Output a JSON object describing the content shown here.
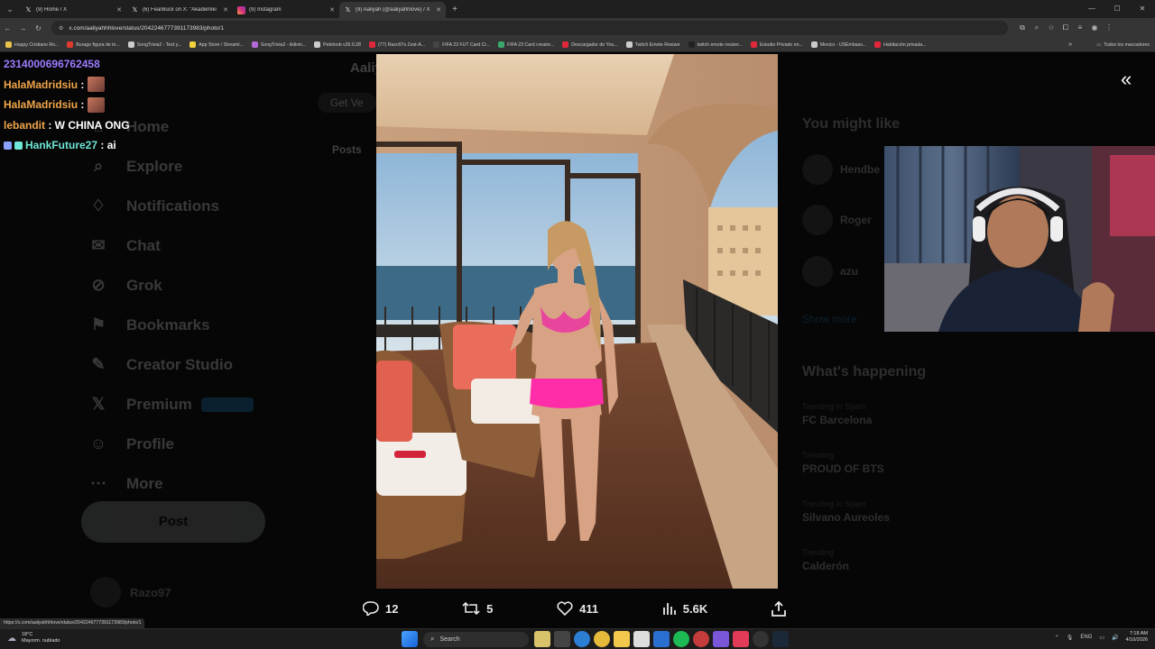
{
  "browser": {
    "tabs": [
      {
        "label": "(9) Home / X",
        "icon": "x-logo-icon",
        "active": false
      },
      {
        "label": "(6) FearBuck on X: \"Akademiki",
        "icon": "x-logo-icon",
        "active": false
      },
      {
        "label": "(9) Instagram",
        "icon": "instagram-icon",
        "active": false
      },
      {
        "label": "(9) Aaliyah (@aaliyahhlove) / X",
        "icon": "x-logo-icon",
        "active": true
      }
    ],
    "url": "x.com/aaliyahhhlove/status/2042246777391173983/photo/1",
    "bookmarks": [
      {
        "label": "Happy Cristiano Ro...",
        "color": "#e8c24a"
      },
      {
        "label": "Burago figura de to...",
        "color": "#e03b2e"
      },
      {
        "label": "SongTrivia2 - Test y...",
        "color": "#cccccc"
      },
      {
        "label": "App Store / Streami...",
        "color": "#f4d23a"
      },
      {
        "label": "SongTrivia2 - Adivin...",
        "color": "#b36ad9"
      },
      {
        "label": "Peletoob v26.0.28",
        "color": "#cccccc"
      },
      {
        "label": "(77) Razo97s Zest-A...",
        "color": "#e0283a"
      },
      {
        "label": "FIFA 23 FUT Card Cr...",
        "color": "#444444"
      },
      {
        "label": "FIFA 23 Card creator...",
        "color": "#3aa86a"
      },
      {
        "label": "Descargador de You...",
        "color": "#e0283a"
      },
      {
        "label": "Twitch Emote Resizer",
        "color": "#cccccc"
      },
      {
        "label": "twitch emote resizer...",
        "color": "#222222"
      },
      {
        "label": "Estudio Privado en...",
        "color": "#e0283a"
      },
      {
        "label": "Mexico - USEmbass...",
        "color": "#cccccc"
      },
      {
        "label": "Habitación privada...",
        "color": "#e0283a"
      }
    ],
    "bookmarks_folder": "Todos los marcadores",
    "status_url": "https://x.com/aaliyahhhlove/status/2042246777391173983/photo/1"
  },
  "chat": [
    {
      "user": "2314000696762458",
      "text": "",
      "user_color": "#9b7bff",
      "emote": false,
      "badge": false
    },
    {
      "user": "HalaMadridsiu",
      "text": " :",
      "user_color": "#f0a54a",
      "emote": true,
      "badge": false
    },
    {
      "user": "HalaMadridsiu",
      "text": " :",
      "user_color": "#f0a54a",
      "emote": true,
      "badge": false
    },
    {
      "user": "lebandit",
      "text": " : W CHINA ONG",
      "user_color": "#f0a54a",
      "emote": false,
      "badge": false
    },
    {
      "user": "HankFuture27",
      "text": " : ai",
      "user_color": "#6fe6d6",
      "emote": false,
      "badge": true
    }
  ],
  "x_nav": {
    "items": [
      {
        "label": "Home",
        "icon": "home-icon"
      },
      {
        "label": "Explore",
        "icon": "search-icon"
      },
      {
        "label": "Notifications",
        "icon": "bell-icon"
      },
      {
        "label": "Chat",
        "icon": "chat-icon"
      },
      {
        "label": "Grok",
        "icon": "grok-icon"
      },
      {
        "label": "Bookmarks",
        "icon": "bookmark-icon"
      },
      {
        "label": "Creator Studio",
        "icon": "creator-studio-icon"
      },
      {
        "label": "Premium",
        "icon": "x-premium-icon"
      },
      {
        "label": "Profile",
        "icon": "person-icon"
      },
      {
        "label": "More",
        "icon": "more-icon"
      }
    ],
    "post_label": "Post",
    "account_name": "Razo97"
  },
  "middle": {
    "title": "Aaliy",
    "pill": "Get Ve",
    "tab": "Posts"
  },
  "right": {
    "you_might_like": "You might like",
    "suggestions": [
      "Hendbe",
      "Roger",
      "azu"
    ],
    "show_more": "Show more",
    "whats_happening": "What's happening",
    "trends": [
      {
        "meta": "Trending in Spain",
        "name": "FC Barcelona"
      },
      {
        "meta": "Trending",
        "name": "PROUD OF BTS"
      },
      {
        "meta": "Trending in Spain",
        "name": "Silvano Aureoles"
      },
      {
        "meta": "Trending",
        "name": "Calderón"
      }
    ]
  },
  "post_actions": {
    "replies": "12",
    "reposts": "5",
    "likes": "411",
    "views": "5.6K"
  },
  "taskbar": {
    "weather_temp": "18°C",
    "weather_desc": "Mayorm. nublado",
    "search_label": "Search",
    "lang": "ENG",
    "time": "7:18 AM",
    "date": "4/10/2026"
  }
}
